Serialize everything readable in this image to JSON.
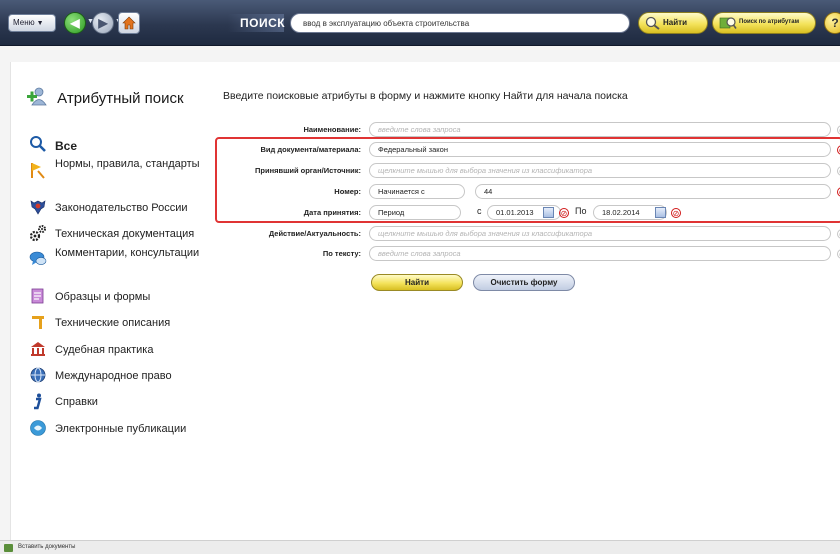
{
  "toolbar": {
    "menu_label": "Меню",
    "search_caption": "ПОИСК",
    "search_value": "ввод в эксплуатацию объекта строительства",
    "find_label": "Найти",
    "attr_search_label": "Поиск по атрибутам",
    "help_glyph": "?"
  },
  "sidebar": {
    "title": "Атрибутный поиск",
    "items": [
      {
        "label": "Все",
        "icon": "magnifier-icon"
      },
      {
        "label": "Нормы, правила, стандарты",
        "icon": "ruler-flag-icon"
      },
      {
        "label": "Законодательство России",
        "icon": "russian-coat-of-arms-icon"
      },
      {
        "label": "Техническая документация",
        "icon": "gears-icon"
      },
      {
        "label": "Комментарии, консультации",
        "icon": "speech-bubbles-icon"
      },
      {
        "label": "Образцы и формы",
        "icon": "form-document-icon"
      },
      {
        "label": "Технические описания",
        "icon": "technical-description-icon"
      },
      {
        "label": "Судебная практика",
        "icon": "court-building-icon"
      },
      {
        "label": "Международное право",
        "icon": "globe-icon"
      },
      {
        "label": "Справки",
        "icon": "info-icon"
      },
      {
        "label": "Электронные публикации",
        "icon": "e-publication-icon"
      }
    ]
  },
  "content": {
    "intro": "Введите поисковые атрибуты в форму и нажмите кнопку Найти для начала поиска"
  },
  "form": {
    "name": {
      "label": "Наименование:",
      "placeholder": "введите слова запроса"
    },
    "doc_type": {
      "label": "Вид документа/материала:",
      "value": "Федеральный закон"
    },
    "issuer": {
      "label": "Принявший орган/Источник:",
      "placeholder": "щелкните мышью для выбора значения из классификатора"
    },
    "number": {
      "label": "Номер:",
      "mode": "Начинается с",
      "value": "44"
    },
    "date": {
      "label": "Дата принятия:",
      "mode": "Период",
      "from_label": "с",
      "from": "01.01.2013",
      "to_label": "По",
      "to": "18.02.2014"
    },
    "status": {
      "label": "Действие/Актуальность:",
      "placeholder": "щелкните мышью для выбора значения из классификатора"
    },
    "text": {
      "label": "По тексту:",
      "placeholder": "введите слова запроса"
    },
    "find_label": "Найти",
    "clear_label": "Очистить форму"
  },
  "status": {
    "text": "Вставить документы"
  },
  "colors": {
    "toolbar": "#2c3850",
    "highlight": "#e03434",
    "yellow_button": "#f4e35b"
  }
}
